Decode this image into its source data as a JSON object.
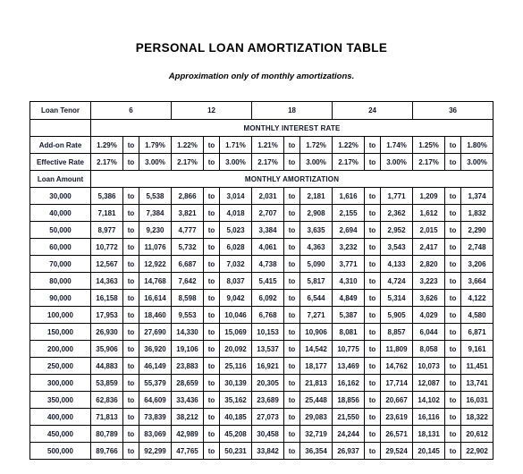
{
  "document": {
    "title": "PERSONAL LOAN AMORTIZATION TABLE",
    "subtitle": "Approximation only of monthly amortizations."
  },
  "table": {
    "row_labels": {
      "loan_tenor": "Loan Tenor",
      "add_on_rate": "Add-on Rate",
      "effective_rate": "Effective Rate",
      "loan_amount": "Loan Amount"
    },
    "band_headers": {
      "interest_rate": "MONTHLY INTEREST RATE",
      "amortization": "MONTHLY AMORTIZATION"
    },
    "separator": "to",
    "tenors": [
      "6",
      "12",
      "18",
      "24",
      "36"
    ],
    "add_on_rate": [
      {
        "low": "1.29%",
        "high": "1.79%"
      },
      {
        "low": "1.22%",
        "high": "1.71%"
      },
      {
        "low": "1.21%",
        "high": "1.72%"
      },
      {
        "low": "1.22%",
        "high": "1.74%"
      },
      {
        "low": "1.25%",
        "high": "1.80%"
      }
    ],
    "effective_rate": [
      {
        "low": "2.17%",
        "high": "3.00%"
      },
      {
        "low": "2.17%",
        "high": "3.00%"
      },
      {
        "low": "2.17%",
        "high": "3.00%"
      },
      {
        "low": "2.17%",
        "high": "3.00%"
      },
      {
        "low": "2.17%",
        "high": "3.00%"
      }
    ],
    "rows": [
      {
        "amount": "30,000",
        "cells": [
          [
            "5,386",
            "5,538"
          ],
          [
            "2,866",
            "3,014"
          ],
          [
            "2,031",
            "2,181"
          ],
          [
            "1,616",
            "1,771"
          ],
          [
            "1,209",
            "1,374"
          ]
        ]
      },
      {
        "amount": "40,000",
        "cells": [
          [
            "7,181",
            "7,384"
          ],
          [
            "3,821",
            "4,018"
          ],
          [
            "2,707",
            "2,908"
          ],
          [
            "2,155",
            "2,362"
          ],
          [
            "1,612",
            "1,832"
          ]
        ]
      },
      {
        "amount": "50,000",
        "cells": [
          [
            "8,977",
            "9,230"
          ],
          [
            "4,777",
            "5,023"
          ],
          [
            "3,384",
            "3,635"
          ],
          [
            "2,694",
            "2,952"
          ],
          [
            "2,015",
            "2,290"
          ]
        ]
      },
      {
        "amount": "60,000",
        "cells": [
          [
            "10,772",
            "11,076"
          ],
          [
            "5,732",
            "6,028"
          ],
          [
            "4,061",
            "4,363"
          ],
          [
            "3,232",
            "3,543"
          ],
          [
            "2,417",
            "2,748"
          ]
        ]
      },
      {
        "amount": "70,000",
        "cells": [
          [
            "12,567",
            "12,922"
          ],
          [
            "6,687",
            "7,032"
          ],
          [
            "4,738",
            "5,090"
          ],
          [
            "3,771",
            "4,133"
          ],
          [
            "2,820",
            "3,206"
          ]
        ]
      },
      {
        "amount": "80,000",
        "cells": [
          [
            "14,363",
            "14,768"
          ],
          [
            "7,642",
            "8,037"
          ],
          [
            "5,415",
            "5,817"
          ],
          [
            "4,310",
            "4,724"
          ],
          [
            "3,223",
            "3,664"
          ]
        ]
      },
      {
        "amount": "90,000",
        "cells": [
          [
            "16,158",
            "16,614"
          ],
          [
            "8,598",
            "9,042"
          ],
          [
            "6,092",
            "6,544"
          ],
          [
            "4,849",
            "5,314"
          ],
          [
            "3,626",
            "4,122"
          ]
        ]
      },
      {
        "amount": "100,000",
        "cells": [
          [
            "17,953",
            "18,460"
          ],
          [
            "9,553",
            "10,046"
          ],
          [
            "6,768",
            "7,271"
          ],
          [
            "5,387",
            "5,905"
          ],
          [
            "4,029",
            "4,580"
          ]
        ]
      },
      {
        "amount": "150,000",
        "cells": [
          [
            "26,930",
            "27,690"
          ],
          [
            "14,330",
            "15,069"
          ],
          [
            "10,153",
            "10,906"
          ],
          [
            "8,081",
            "8,857"
          ],
          [
            "6,044",
            "6,871"
          ]
        ]
      },
      {
        "amount": "200,000",
        "cells": [
          [
            "35,906",
            "36,920"
          ],
          [
            "19,106",
            "20,092"
          ],
          [
            "13,537",
            "14,542"
          ],
          [
            "10,775",
            "11,809"
          ],
          [
            "8,058",
            "9,161"
          ]
        ]
      },
      {
        "amount": "250,000",
        "cells": [
          [
            "44,883",
            "46,149"
          ],
          [
            "23,883",
            "25,116"
          ],
          [
            "16,921",
            "18,177"
          ],
          [
            "13,469",
            "14,762"
          ],
          [
            "10,073",
            "11,451"
          ]
        ]
      },
      {
        "amount": "300,000",
        "cells": [
          [
            "53,859",
            "55,379"
          ],
          [
            "28,659",
            "30,139"
          ],
          [
            "20,305",
            "21,813"
          ],
          [
            "16,162",
            "17,714"
          ],
          [
            "12,087",
            "13,741"
          ]
        ]
      },
      {
        "amount": "350,000",
        "cells": [
          [
            "62,836",
            "64,609"
          ],
          [
            "33,436",
            "35,162"
          ],
          [
            "23,689",
            "25,448"
          ],
          [
            "18,856",
            "20,667"
          ],
          [
            "14,102",
            "16,031"
          ]
        ]
      },
      {
        "amount": "400,000",
        "cells": [
          [
            "71,813",
            "73,839"
          ],
          [
            "38,212",
            "40,185"
          ],
          [
            "27,073",
            "29,083"
          ],
          [
            "21,550",
            "23,619"
          ],
          [
            "16,116",
            "18,322"
          ]
        ]
      },
      {
        "amount": "450,000",
        "cells": [
          [
            "80,789",
            "83,069"
          ],
          [
            "42,989",
            "45,208"
          ],
          [
            "30,458",
            "32,719"
          ],
          [
            "24,244",
            "26,571"
          ],
          [
            "18,131",
            "20,612"
          ]
        ]
      },
      {
        "amount": "500,000",
        "cells": [
          [
            "89,766",
            "92,299"
          ],
          [
            "47,765",
            "50,231"
          ],
          [
            "33,842",
            "36,354"
          ],
          [
            "26,937",
            "29,524"
          ],
          [
            "20,145",
            "22,902"
          ]
        ]
      }
    ]
  },
  "colors": {
    "text": "#11172b",
    "border": "#000000",
    "background": "#ffffff"
  }
}
